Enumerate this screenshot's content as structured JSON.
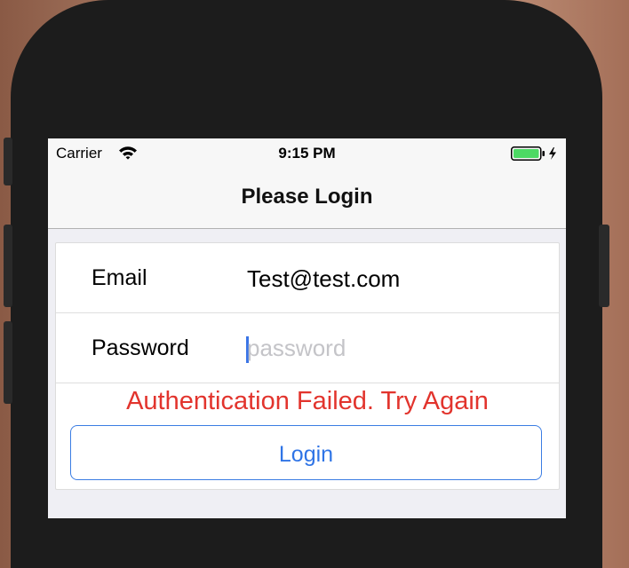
{
  "status_bar": {
    "carrier": "Carrier",
    "time": "9:15 PM",
    "wifi_icon": "wifi-icon",
    "battery_icon": "battery-charging-icon",
    "battery_color": "#4cd964"
  },
  "nav": {
    "title": "Please Login"
  },
  "form": {
    "email": {
      "label": "Email",
      "value": "Test@test.com"
    },
    "password": {
      "label": "Password",
      "value": "",
      "placeholder": "password"
    },
    "error_message": "Authentication Failed. Try Again",
    "error_color": "#e2342d",
    "login_label": "Login",
    "accent_color": "#2f74e6"
  }
}
